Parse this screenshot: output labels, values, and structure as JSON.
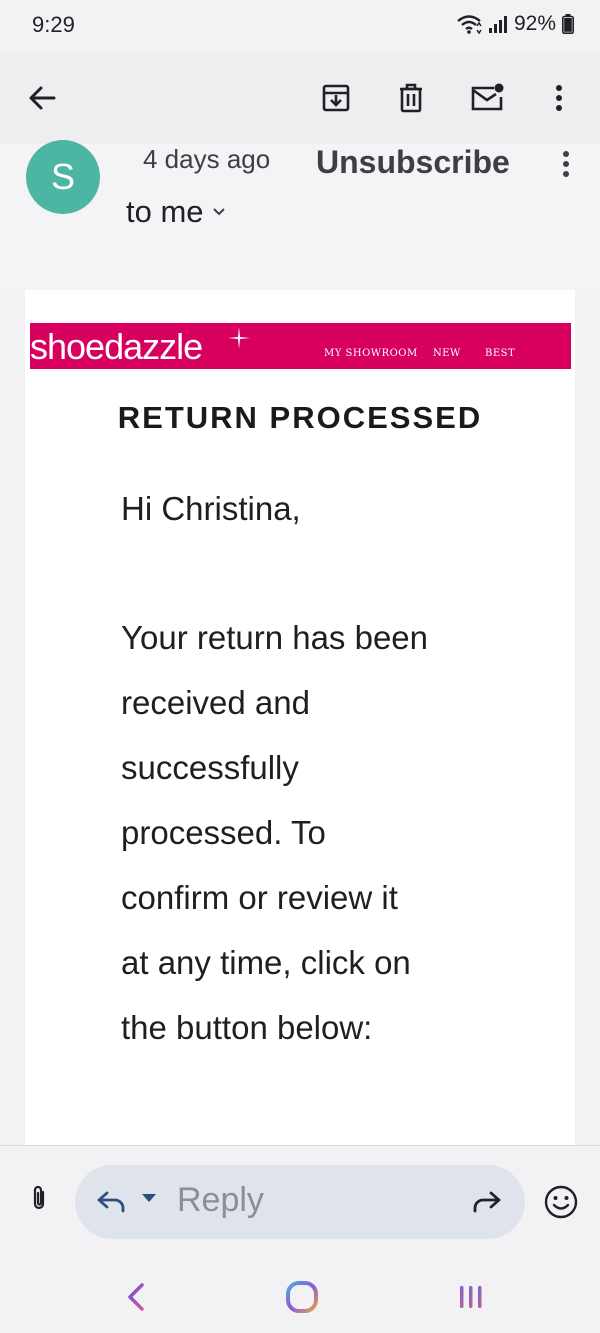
{
  "status_bar": {
    "time": "9:29",
    "battery": "92%"
  },
  "toolbar": {
    "back": "arrow-back-icon",
    "archive": "archive-icon",
    "delete": "trash-icon",
    "mark_unread": "mark-unread-icon",
    "more": "more-vert-icon"
  },
  "sender": {
    "avatar_letter": "S",
    "avatar_color": "#4db6a3",
    "date": "4 days ago",
    "recipient": "to me",
    "unsubscribe": "Unsubscribe"
  },
  "email": {
    "brand": {
      "logo_text": "shoedazzle",
      "color": "#d8005f",
      "nav": [
        "MY SHOWROOM",
        "NEW",
        "BEST SELLERS"
      ]
    },
    "heading": "RETURN PROCESSED",
    "greeting": "Hi Christina,",
    "paragraph_lines": [
      "Your return has been",
      "received and",
      "successfully",
      "processed. To",
      "confirm or review it",
      "at any time, click on",
      "the button below:"
    ]
  },
  "reply_bar": {
    "placeholder": "Reply"
  },
  "nav_bar": {
    "back": "nav-back-icon",
    "home": "nav-home-icon",
    "recents": "nav-recents-icon"
  }
}
